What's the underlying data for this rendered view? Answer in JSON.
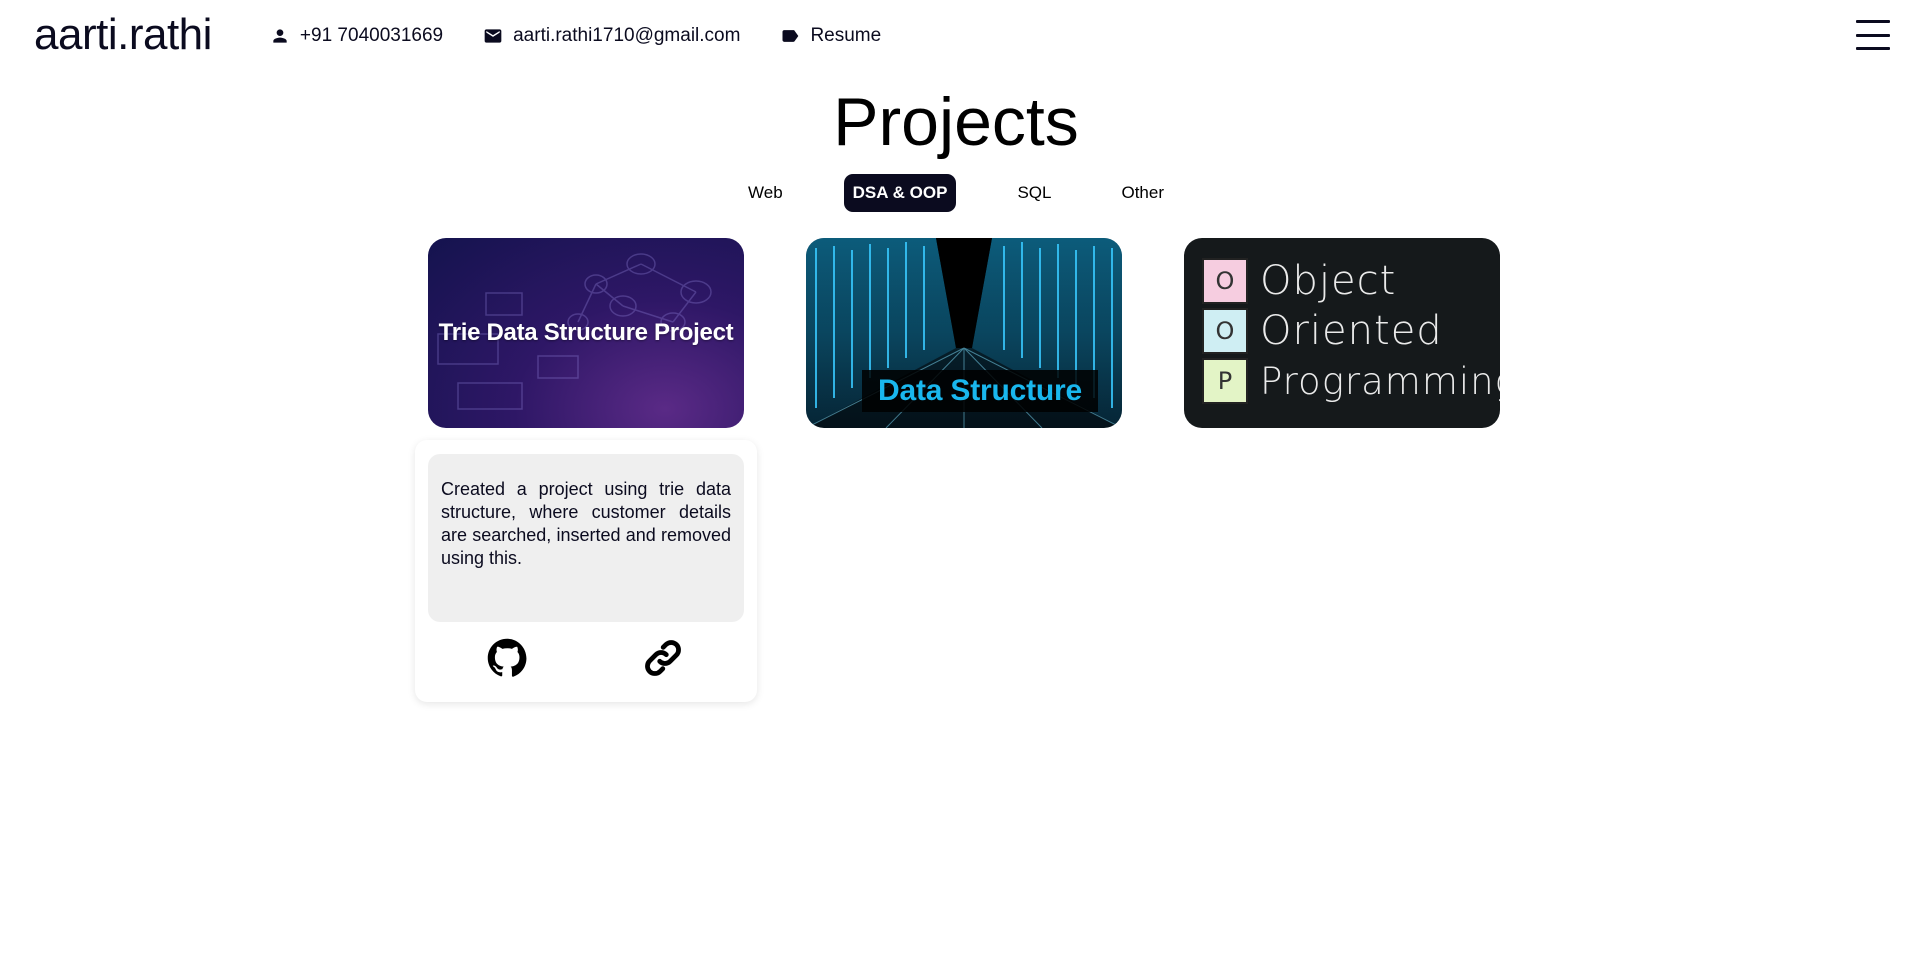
{
  "header": {
    "brand": "aarti.rathi",
    "phone": "+91 7040031669",
    "email": "aarti.rathi1710@gmail.com",
    "resume": "Resume",
    "icons": {
      "phone": "person-icon",
      "email": "mail-icon",
      "resume": "label-icon",
      "menu": "hamburger-menu-icon"
    }
  },
  "page": {
    "title": "Projects"
  },
  "tabs": [
    {
      "label": "Web",
      "active": false
    },
    {
      "label": "DSA & OOP",
      "active": true
    },
    {
      "label": "SQL",
      "active": false
    },
    {
      "label": "Other",
      "active": false
    }
  ],
  "projects": [
    {
      "thumb_text": "Trie Data Structure Project"
    },
    {
      "thumb_text": "Data Structure"
    },
    {
      "thumb_letters": [
        "O",
        "O",
        "P"
      ],
      "thumb_words": [
        "Object",
        "Oriented",
        "Programming"
      ]
    }
  ],
  "detail": {
    "description": "Created a project using trie data structure, where customer details are searched, inserted and removed using this.",
    "icons": [
      "github-icon",
      "link-icon"
    ]
  },
  "colors": {
    "primary": "#0b0b1f",
    "card_bg": "#efefef",
    "ds_text": "#19b7ee",
    "oop_pink": "#f6cde0",
    "oop_blue": "#cfeef3",
    "oop_green": "#e3f4c6"
  }
}
